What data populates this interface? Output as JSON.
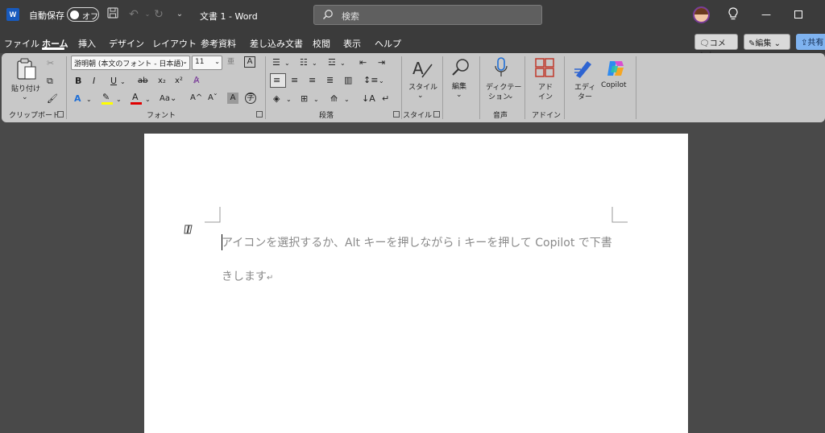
{
  "titlebar": {
    "app_icon_letter": "W",
    "autosave_label": "自動保存",
    "autosave_state": "オフ",
    "doc_title": "文書 1  -  Word",
    "search_placeholder": "検索"
  },
  "tabs": [
    "ファイル",
    "ホーム",
    "挿入",
    "デザイン",
    "レイアウト",
    "参考資料",
    "差し込み文書",
    "校閲",
    "表示",
    "ヘルプ"
  ],
  "active_tab": "ホーム",
  "comment_label": "コメント",
  "edit_label": "編集",
  "share_label": "共有",
  "ribbon": {
    "clipboard": {
      "paste": "貼り付け",
      "label": "クリップボード"
    },
    "font": {
      "name": "游明朝 (本文のフォント - 日本語)",
      "size": "11",
      "label": "フォント"
    },
    "paragraph": {
      "label": "段落"
    },
    "styles": {
      "button": "スタイル",
      "label": "スタイル"
    },
    "editing": {
      "button": "編集"
    },
    "voice": {
      "button_line1": "ディクテー",
      "button_line2": "ション",
      "label": "音声"
    },
    "addins": {
      "button_line1": "アド",
      "button_line2": "イン",
      "label": "アドイン"
    },
    "editor": {
      "button_line1": "エディ",
      "button_line2": "ター"
    },
    "copilot": {
      "button": "Copilot"
    }
  },
  "document": {
    "line1": "アイコンを選択するか、Alt キーを押しながら i キーを押して Copilot で下書",
    "line2": "きします",
    "paragraph_mark": "↵"
  },
  "colors": {
    "titlebar": "#3b3b3b",
    "ribbon": "#c8c8c8",
    "workspace": "#494949",
    "word_blue": "#185abd",
    "highlight_yellow": "#ffff00",
    "font_red": "#e00000",
    "share_blue": "#7fb3f0"
  }
}
